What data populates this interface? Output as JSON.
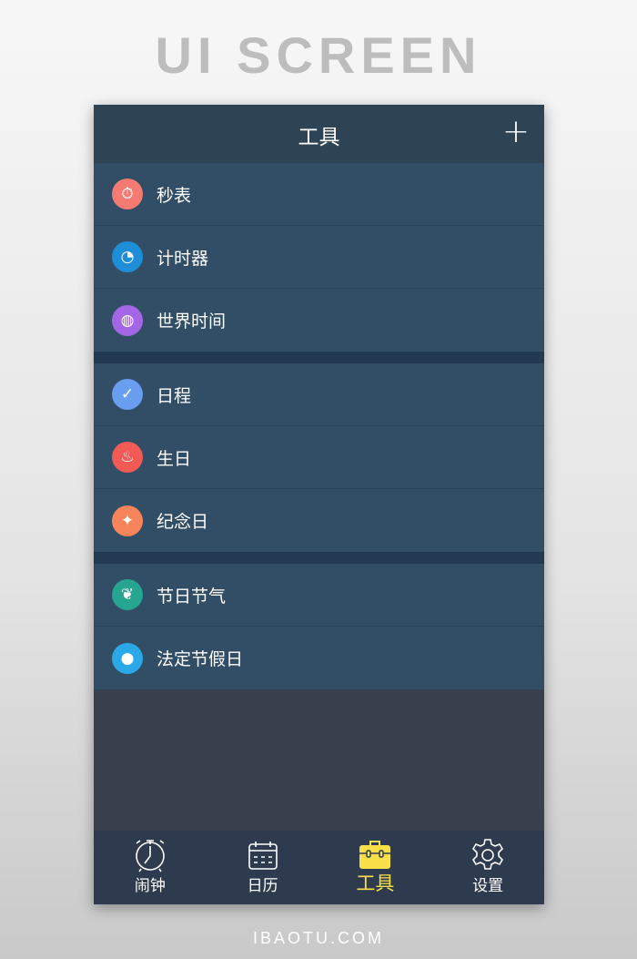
{
  "banner": "UI SCREEN",
  "footer": "IBAOTU.COM",
  "header": {
    "title": "工具",
    "add_icon": "plus-icon"
  },
  "groups": [
    [
      {
        "label": "秒表",
        "icon": "stopwatch-icon",
        "color": "#f47a72"
      },
      {
        "label": "计时器",
        "icon": "clock-icon",
        "color": "#1e8ed9"
      },
      {
        "label": "世界时间",
        "icon": "globe-icon",
        "color": "#a466e6"
      }
    ],
    [
      {
        "label": "日程",
        "icon": "clipboard-check-icon",
        "color": "#6a9ef0"
      },
      {
        "label": "生日",
        "icon": "cake-icon",
        "color": "#f25a55"
      },
      {
        "label": "纪念日",
        "icon": "party-popper-icon",
        "color": "#f7845a"
      }
    ],
    [
      {
        "label": "节日节气",
        "icon": "leaf-icon",
        "color": "#26a590"
      },
      {
        "label": "法定节假日",
        "icon": "balloon-icon",
        "color": "#2aa8e8"
      }
    ]
  ],
  "tabs": [
    {
      "label": "闹钟",
      "icon": "alarm-clock-icon"
    },
    {
      "label": "日历",
      "icon": "calendar-icon"
    },
    {
      "label": "工具",
      "icon": "toolbox-icon",
      "active": true,
      "active_color": "#f9e04b"
    },
    {
      "label": "设置",
      "icon": "gear-icon"
    }
  ]
}
